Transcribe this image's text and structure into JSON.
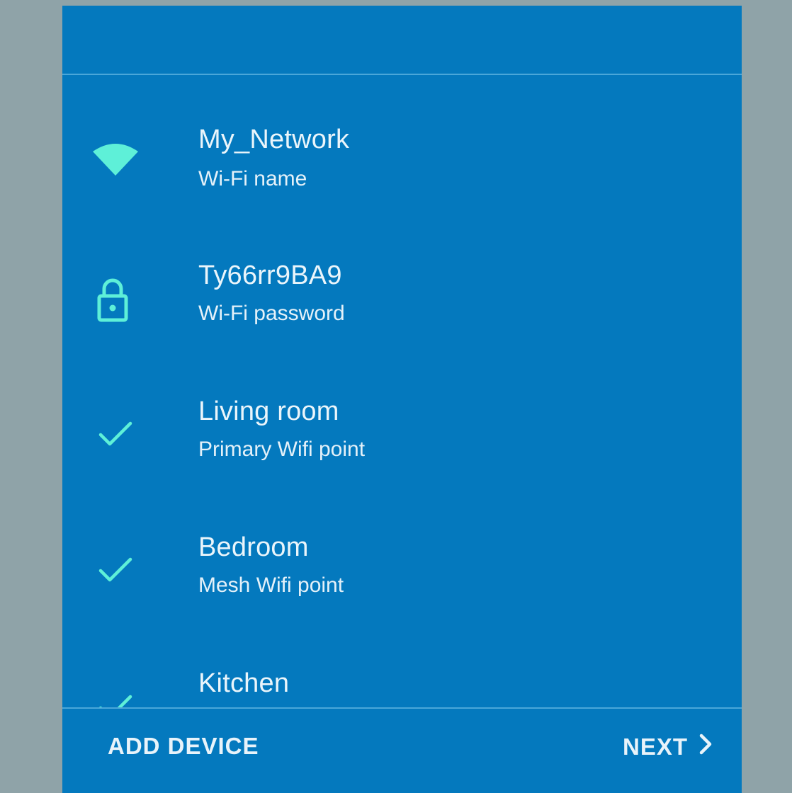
{
  "network": {
    "name": "My_Network",
    "name_label": "Wi-Fi name",
    "password": "Ty66rr9BA9",
    "password_label": "Wi-Fi password"
  },
  "devices": [
    {
      "title": "Living room",
      "subtitle": "Primary Wifi point",
      "icon": "check-icon"
    },
    {
      "title": "Bedroom",
      "subtitle": "Mesh Wifi point",
      "icon": "check-icon"
    },
    {
      "title": "Kitchen",
      "subtitle": "",
      "icon": "check-icon"
    }
  ],
  "footer": {
    "add_label": "ADD DEVICE",
    "next_label": "NEXT"
  },
  "colors": {
    "panel": "#0479be",
    "side": "#8fa3a8",
    "accent": "#5ef0d8"
  }
}
